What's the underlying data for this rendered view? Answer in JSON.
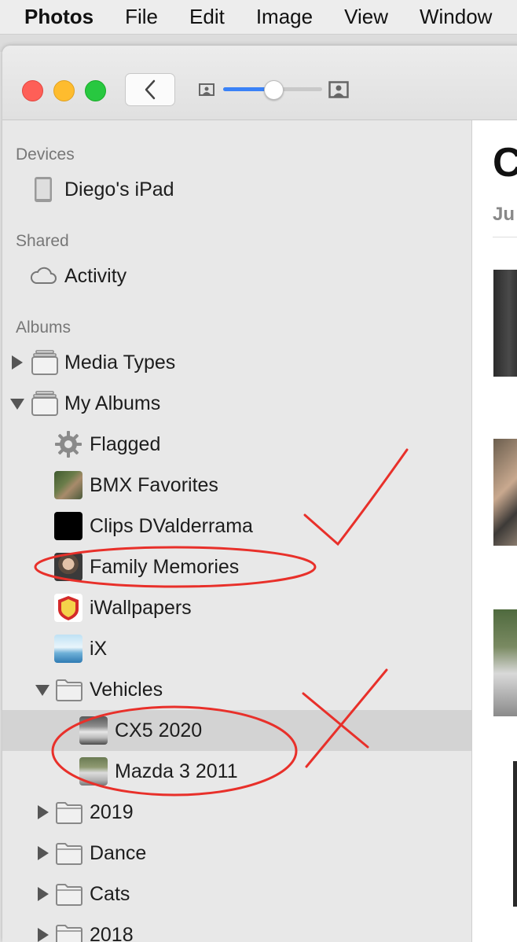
{
  "menubar": {
    "app_name": "Photos",
    "items": [
      "File",
      "Edit",
      "Image",
      "View",
      "Window"
    ]
  },
  "toolbar": {
    "back_icon": "chevron-left-icon",
    "zoom_level": 0.5
  },
  "sidebar": {
    "devices_header": "Devices",
    "device_label": "Diego's iPad",
    "shared_header": "Shared",
    "activity_label": "Activity",
    "albums_header": "Albums",
    "media_types_label": "Media Types",
    "my_albums_label": "My Albums",
    "albums": [
      {
        "label": "Flagged"
      },
      {
        "label": "BMX Favorites"
      },
      {
        "label": "Clips DValderrama"
      },
      {
        "label": "Family Memories"
      },
      {
        "label": "iWallpapers"
      },
      {
        "label": "iX"
      }
    ],
    "vehicles_label": "Vehicles",
    "vehicle_albums": [
      {
        "label": "CX5 2020",
        "selected": true
      },
      {
        "label": "Mazda 3 2011",
        "selected": false
      }
    ],
    "folders": [
      {
        "label": "2019"
      },
      {
        "label": "Dance"
      },
      {
        "label": "Cats"
      },
      {
        "label": "2018"
      }
    ]
  },
  "main": {
    "title": "C",
    "subtitle": "Ju"
  },
  "colors": {
    "selection": "#d3d3d3",
    "annotation_red": "#e8302a",
    "slider_accent": "#3a82f7"
  }
}
